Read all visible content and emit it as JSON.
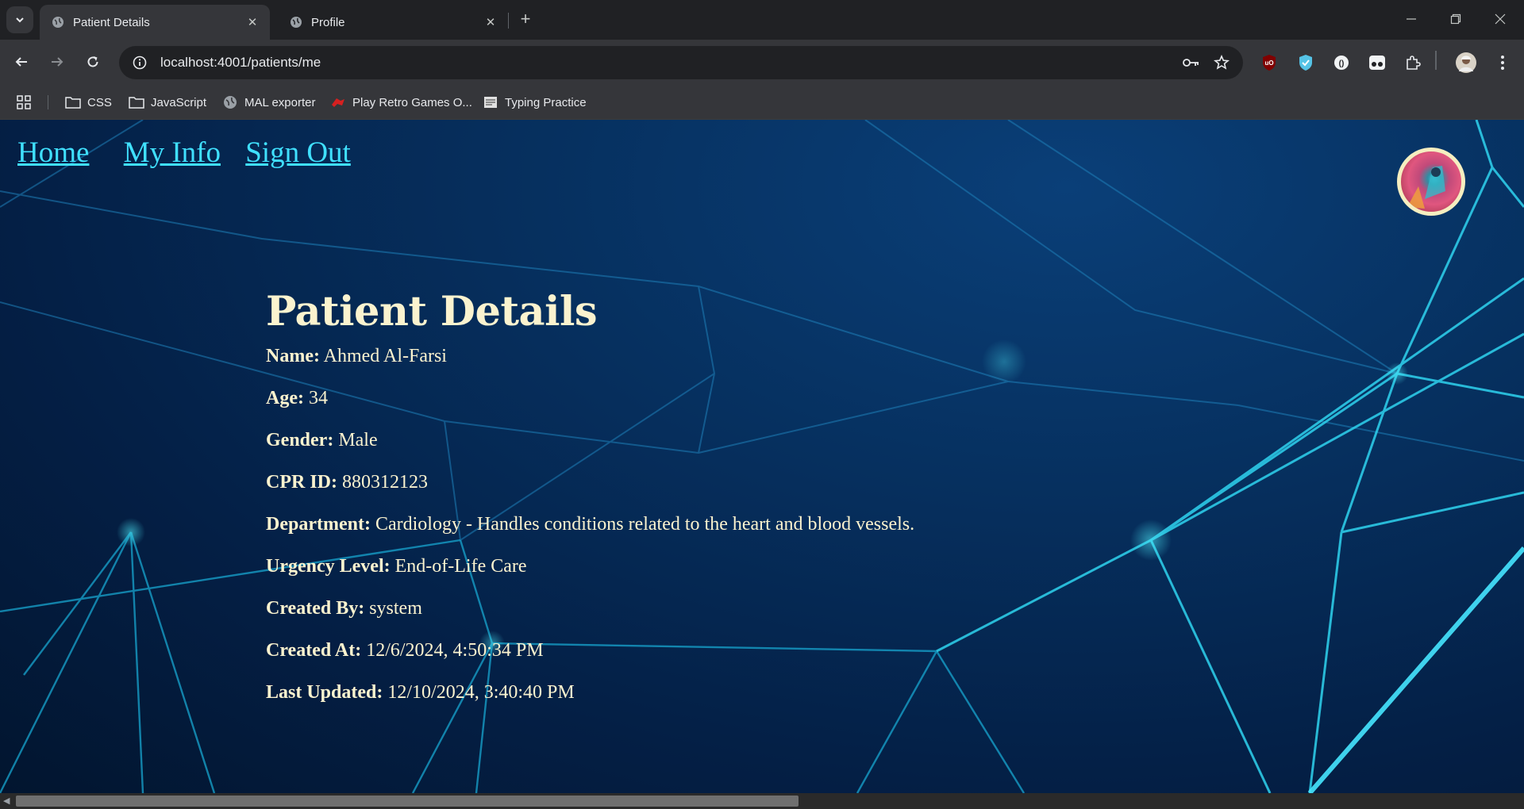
{
  "browser": {
    "tabs": [
      {
        "label": "Patient Details",
        "active": true
      },
      {
        "label": "Profile",
        "active": false
      }
    ],
    "url": "localhost:4001/patients/me",
    "bookmarks": [
      {
        "label": "CSS",
        "icon": "folder-icon"
      },
      {
        "label": "JavaScript",
        "icon": "folder-icon"
      },
      {
        "label": "MAL exporter",
        "icon": "globe-icon"
      },
      {
        "label": "Play Retro Games O...",
        "icon": "game-icon"
      },
      {
        "label": "Typing Practice",
        "icon": "keyboard-icon"
      }
    ]
  },
  "nav": {
    "home": "Home",
    "my_info": "My Info",
    "sign_out": "Sign Out"
  },
  "patient": {
    "heading": "Patient Details",
    "fields": [
      {
        "label": "Name:",
        "value": "Ahmed Al-Farsi"
      },
      {
        "label": "Age:",
        "value": "34"
      },
      {
        "label": "Gender:",
        "value": "Male"
      },
      {
        "label": "CPR ID:",
        "value": "880312123"
      },
      {
        "label": "Department:",
        "value": "Cardiology - Handles conditions related to the heart and blood vessels."
      },
      {
        "label": "Urgency Level:",
        "value": "End-of-Life Care"
      },
      {
        "label": "Created By:",
        "value": "system"
      },
      {
        "label": "Created At:",
        "value": "12/6/2024, 4:50:34 PM"
      },
      {
        "label": "Last Updated:",
        "value": "12/10/2024, 3:40:40 PM"
      }
    ]
  },
  "colors": {
    "link": "#40e0ff",
    "text": "#fbf3cf",
    "background": "#041f45"
  }
}
